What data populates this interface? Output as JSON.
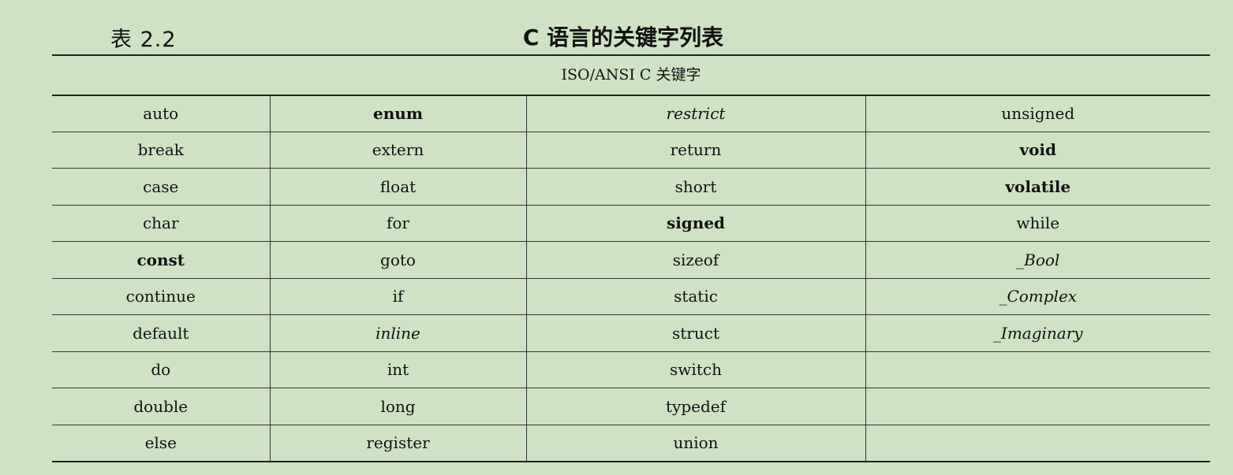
{
  "header": {
    "table_label": "表 2.2",
    "table_title": "C 语言的关键字列表"
  },
  "caption": "ISO/ANSI C 关键字",
  "rows": [
    [
      {
        "text": "auto",
        "style": ""
      },
      {
        "text": "enum",
        "style": "b"
      },
      {
        "text": "restrict",
        "style": "i"
      },
      {
        "text": "unsigned",
        "style": ""
      }
    ],
    [
      {
        "text": "break",
        "style": ""
      },
      {
        "text": "extern",
        "style": ""
      },
      {
        "text": "return",
        "style": ""
      },
      {
        "text": "void",
        "style": "b"
      }
    ],
    [
      {
        "text": "case",
        "style": ""
      },
      {
        "text": "float",
        "style": ""
      },
      {
        "text": "short",
        "style": ""
      },
      {
        "text": "volatile",
        "style": "b"
      }
    ],
    [
      {
        "text": "char",
        "style": ""
      },
      {
        "text": "for",
        "style": ""
      },
      {
        "text": "signed",
        "style": "b"
      },
      {
        "text": "while",
        "style": ""
      }
    ],
    [
      {
        "text": "const",
        "style": "b"
      },
      {
        "text": "goto",
        "style": ""
      },
      {
        "text": "sizeof",
        "style": ""
      },
      {
        "text": "_Bool",
        "style": "i"
      }
    ],
    [
      {
        "text": "continue",
        "style": ""
      },
      {
        "text": "if",
        "style": ""
      },
      {
        "text": "static",
        "style": ""
      },
      {
        "text": "_Complex",
        "style": "i"
      }
    ],
    [
      {
        "text": "default",
        "style": ""
      },
      {
        "text": "inline",
        "style": "i"
      },
      {
        "text": "struct",
        "style": ""
      },
      {
        "text": "_Imaginary",
        "style": "i"
      }
    ],
    [
      {
        "text": "do",
        "style": ""
      },
      {
        "text": "int",
        "style": ""
      },
      {
        "text": "switch",
        "style": ""
      },
      {
        "text": "",
        "style": ""
      }
    ],
    [
      {
        "text": "double",
        "style": ""
      },
      {
        "text": "long",
        "style": ""
      },
      {
        "text": "typedef",
        "style": ""
      },
      {
        "text": "",
        "style": ""
      }
    ],
    [
      {
        "text": "else",
        "style": ""
      },
      {
        "text": "register",
        "style": ""
      },
      {
        "text": "union",
        "style": ""
      },
      {
        "text": "",
        "style": ""
      }
    ]
  ]
}
